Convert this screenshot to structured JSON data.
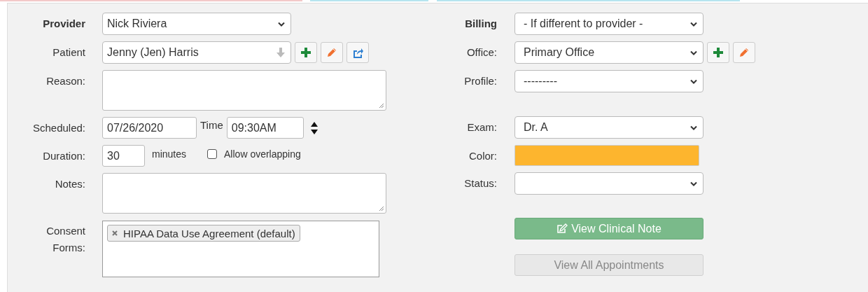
{
  "left_fields": [
    {
      "kind": "select",
      "label": "Provider",
      "bold": true,
      "value": "Nick Riviera"
    },
    {
      "kind": "select",
      "label": "Patient",
      "bold": false,
      "value": "Jenny (Jen) Harris",
      "lookup": true,
      "actions": [
        {
          "kind": "add"
        },
        {
          "kind": "edit"
        },
        {
          "kind": "share"
        }
      ]
    },
    {
      "kind": "textarea",
      "label": "Reason:",
      "bold": false
    },
    {
      "kind": "datetime",
      "label": "Scheduled:",
      "bold": false,
      "date": "07/26/2020",
      "time_label": "Time",
      "time": "09:30AM"
    },
    {
      "kind": "duration",
      "label": "Duration:",
      "bold": false,
      "value": "30",
      "unit": "minutes",
      "option": {
        "label": "Allow overlapping",
        "checked": false
      }
    },
    {
      "kind": "textarea",
      "label": "Notes:",
      "bold": false
    },
    {
      "kind": "tags",
      "label": "Consent Forms:",
      "bold": false,
      "tags": [
        "HIPAA Data Use Agreement (default)"
      ]
    }
  ],
  "right_fields": [
    {
      "kind": "select",
      "label": "Billing",
      "bold": true,
      "value": "- If different to provider -"
    },
    {
      "kind": "select",
      "label": "Office:",
      "bold": false,
      "value": "Primary Office",
      "actions": [
        {
          "kind": "add"
        },
        {
          "kind": "edit"
        }
      ]
    },
    {
      "kind": "select",
      "label": "Profile:",
      "bold": false,
      "value": "---------"
    },
    {
      "kind": "select",
      "label": "Exam:",
      "bold": false,
      "value": "Dr. A"
    },
    {
      "kind": "color",
      "label": "Color:",
      "bold": false,
      "color": "#fdb52e"
    },
    {
      "kind": "select",
      "label": "Status:",
      "bold": false
    }
  ],
  "buttons": [
    {
      "kind": "note",
      "label": "View Clinical Note",
      "disabled": false
    },
    {
      "kind": "plain",
      "label": "View All Appointments",
      "disabled": true
    }
  ]
}
